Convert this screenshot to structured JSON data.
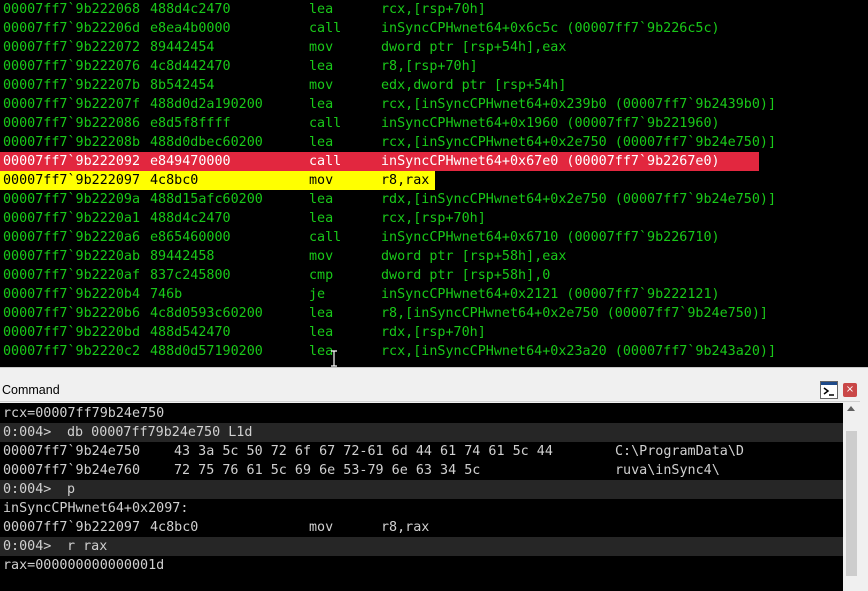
{
  "disassembly": [
    {
      "addr": "00007ff7`9b222068",
      "bytes": "488d4c2470",
      "mnemonic": "lea",
      "operands": "rcx,[rsp+70h]",
      "state": ""
    },
    {
      "addr": "00007ff7`9b22206d",
      "bytes": "e8ea4b0000",
      "mnemonic": "call",
      "operands": "inSyncCPHwnet64+0x6c5c (00007ff7`9b226c5c)",
      "state": ""
    },
    {
      "addr": "00007ff7`9b222072",
      "bytes": "89442454",
      "mnemonic": "mov",
      "operands": "dword ptr [rsp+54h],eax",
      "state": ""
    },
    {
      "addr": "00007ff7`9b222076",
      "bytes": "4c8d442470",
      "mnemonic": "lea",
      "operands": "r8,[rsp+70h]",
      "state": ""
    },
    {
      "addr": "00007ff7`9b22207b",
      "bytes": "8b542454",
      "mnemonic": "mov",
      "operands": "edx,dword ptr [rsp+54h]",
      "state": ""
    },
    {
      "addr": "00007ff7`9b22207f",
      "bytes": "488d0d2a190200",
      "mnemonic": "lea",
      "operands": "rcx,[inSyncCPHwnet64+0x239b0 (00007ff7`9b2439b0)]",
      "state": ""
    },
    {
      "addr": "00007ff7`9b222086",
      "bytes": "e8d5f8ffff",
      "mnemonic": "call",
      "operands": "inSyncCPHwnet64+0x1960 (00007ff7`9b221960)",
      "state": ""
    },
    {
      "addr": "00007ff7`9b22208b",
      "bytes": "488d0dbec60200",
      "mnemonic": "lea",
      "operands": "rcx,[inSyncCPHwnet64+0x2e750 (00007ff7`9b24e750)]",
      "state": ""
    },
    {
      "addr": "00007ff7`9b222092",
      "bytes": "e849470000",
      "mnemonic": "call",
      "operands": "inSyncCPHwnet64+0x67e0 (00007ff7`9b2267e0)",
      "state": "breakpoint"
    },
    {
      "addr": "00007ff7`9b222097",
      "bytes": "4c8bc0",
      "mnemonic": "mov",
      "operands": "r8,rax",
      "state": "current"
    },
    {
      "addr": "00007ff7`9b22209a",
      "bytes": "488d15afc60200",
      "mnemonic": "lea",
      "operands": "rdx,[inSyncCPHwnet64+0x2e750 (00007ff7`9b24e750)]",
      "state": ""
    },
    {
      "addr": "00007ff7`9b2220a1",
      "bytes": "488d4c2470",
      "mnemonic": "lea",
      "operands": "rcx,[rsp+70h]",
      "state": ""
    },
    {
      "addr": "00007ff7`9b2220a6",
      "bytes": "e865460000",
      "mnemonic": "call",
      "operands": "inSyncCPHwnet64+0x6710 (00007ff7`9b226710)",
      "state": ""
    },
    {
      "addr": "00007ff7`9b2220ab",
      "bytes": "89442458",
      "mnemonic": "mov",
      "operands": "dword ptr [rsp+58h],eax",
      "state": ""
    },
    {
      "addr": "00007ff7`9b2220af",
      "bytes": "837c245800",
      "mnemonic": "cmp",
      "operands": "dword ptr [rsp+58h],0",
      "state": ""
    },
    {
      "addr": "00007ff7`9b2220b4",
      "bytes": "746b",
      "mnemonic": "je",
      "operands": "inSyncCPHwnet64+0x2121 (00007ff7`9b222121)",
      "state": ""
    },
    {
      "addr": "00007ff7`9b2220b6",
      "bytes": "4c8d0593c60200",
      "mnemonic": "lea",
      "operands": "r8,[inSyncCPHwnet64+0x2e750 (00007ff7`9b24e750)]",
      "state": ""
    },
    {
      "addr": "00007ff7`9b2220bd",
      "bytes": "488d542470",
      "mnemonic": "lea",
      "operands": "rdx,[rsp+70h]",
      "state": ""
    },
    {
      "addr": "00007ff7`9b2220c2",
      "bytes": "488d0d57190200",
      "mnemonic": "lea",
      "operands": "rcx,[inSyncCPHwnet64+0x23a20 (00007ff7`9b243a20)]",
      "state": ""
    }
  ],
  "command_window": {
    "title": "Command",
    "close_label": "×",
    "lines": [
      {
        "kind": "text",
        "text": "rcx=00007ff79b24e750"
      },
      {
        "kind": "prompt",
        "prompt": "0:004>",
        "cmd": "db 00007ff79b24e750 L1d"
      },
      {
        "kind": "dump",
        "addr": "00007ff7`9b24e750",
        "hex": "43 3a 5c 50 72 6f 67 72-61 6d 44 61 74 61 5c 44",
        "ascii": "C:\\ProgramData\\D"
      },
      {
        "kind": "dump",
        "addr": "00007ff7`9b24e760",
        "hex": "72 75 76 61 5c 69 6e 53-79 6e 63 34 5c",
        "ascii": "ruva\\inSync4\\"
      },
      {
        "kind": "prompt",
        "prompt": "0:004>",
        "cmd": "p"
      },
      {
        "kind": "text",
        "text": "inSyncCPHwnet64+0x2097:"
      },
      {
        "kind": "disasm",
        "addr": "00007ff7`9b222097",
        "bytes": "4c8bc0",
        "mnemonic": "mov",
        "operands": "r8,rax"
      },
      {
        "kind": "prompt",
        "prompt": "0:004>",
        "cmd": "r rax"
      },
      {
        "kind": "text",
        "text": "rax=000000000000001d"
      }
    ]
  },
  "colors": {
    "disasm_text": "#19c919",
    "breakpoint_bg": "#e2273f",
    "current_bg": "#ffff00"
  },
  "icons": {
    "cmd_icon": "command-prompt-icon",
    "close": "close-icon",
    "scroll_up": "scroll-up-arrow-icon"
  }
}
